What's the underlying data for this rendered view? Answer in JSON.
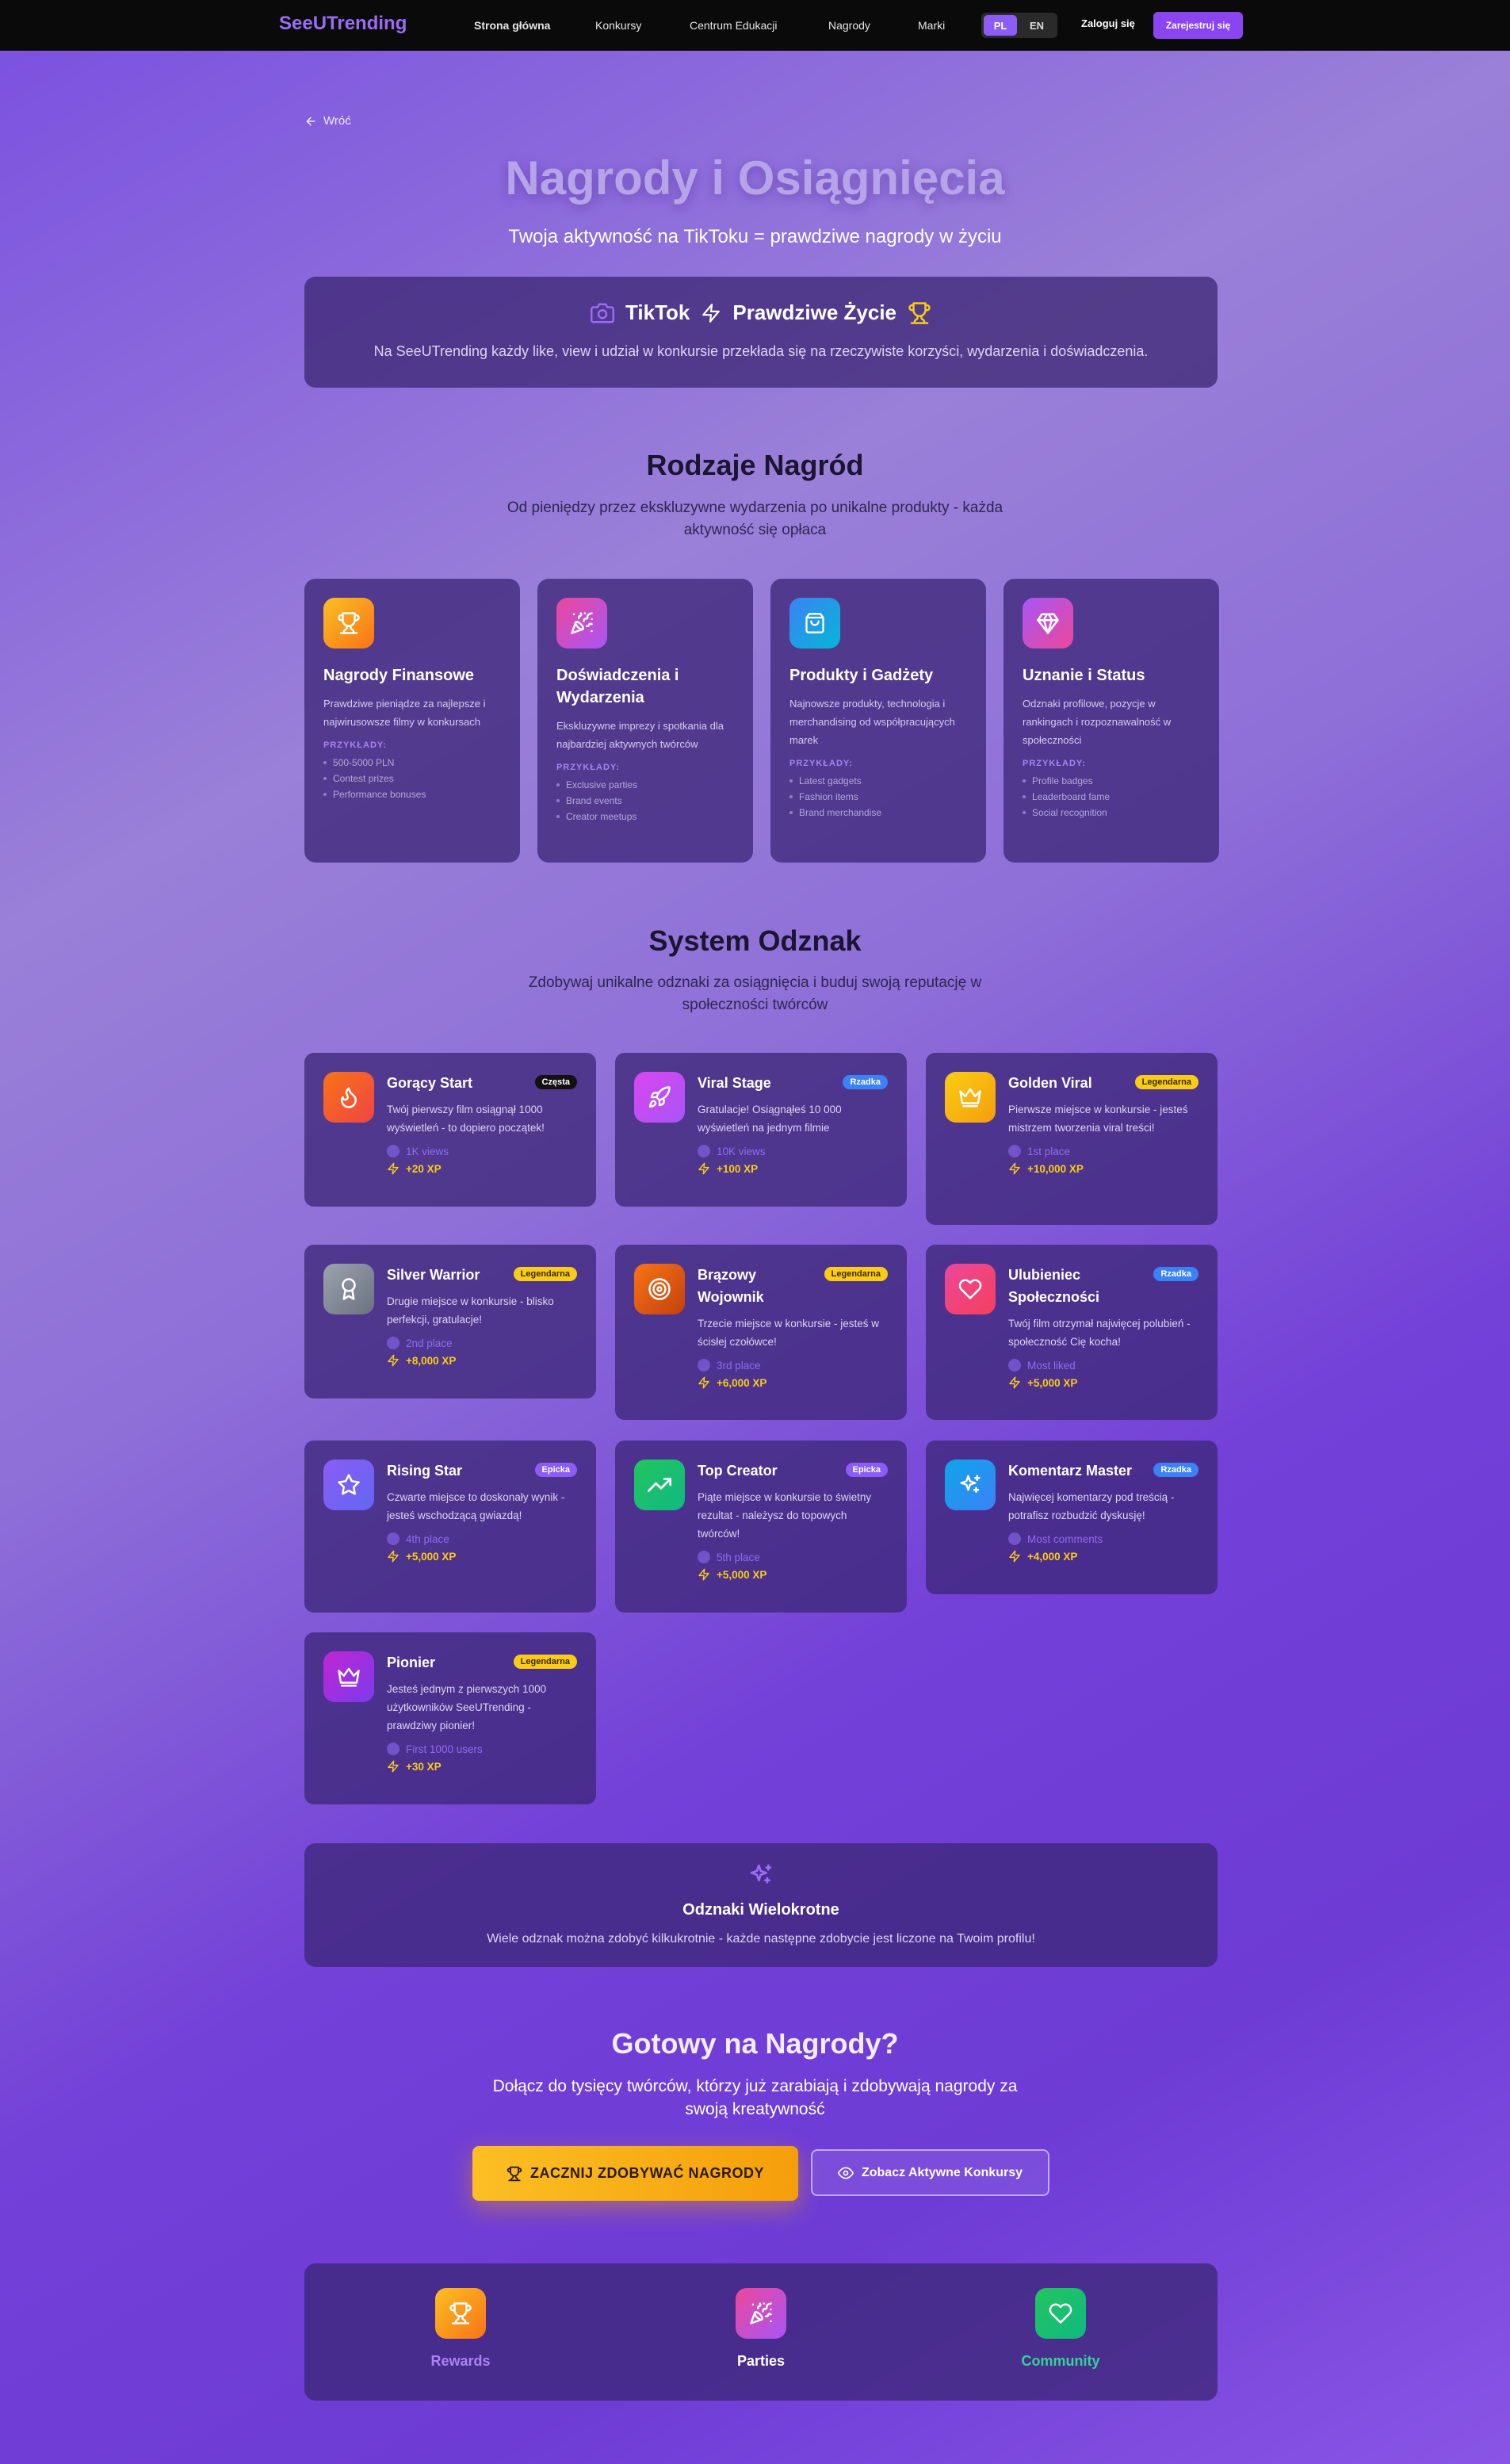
{
  "nav": {
    "brand": "SeeUTrending",
    "links": [
      "Strona główna",
      "Konkursy",
      "Centrum Edukacji",
      "Nagrody",
      "Marki"
    ],
    "lang_pl": "PL",
    "lang_en": "EN",
    "login": "Zaloguj się",
    "register": "Zarejestruj się"
  },
  "colors": {
    "accent": "#8b5cf6",
    "gold": "#facc15",
    "card_bg": "#3e2878"
  },
  "back": {
    "label": "Wróć",
    "icon": "arrow-left-icon"
  },
  "hero": {
    "title": "Nagrody i Osiągnięcia",
    "subtitle": "Twoja aktywność na TikToku = prawdziwe nagrody w życiu",
    "tiktok": "TikTok",
    "real_life": "Prawdziwe Życie",
    "description": "Na SeeUTrending każdy like, view i udział w konkursie przekłada się na rzeczywiste korzyści, wydarzenia i doświadczenia."
  },
  "reward_types": {
    "title": "Rodzaje Nagród",
    "subtitle": "Od pieniędzy przez ekskluzywne wydarzenia po unikalne produkty - każda aktywność się opłaca",
    "examples_label": "PRZYKŁADY:",
    "cards": [
      {
        "icon": "trophy-icon",
        "title": "Nagrody Finansowe",
        "description": "Prawdziwe pieniądze za najlepsze i najwirusowsze filmy w konkursach",
        "examples": [
          "500-5000 PLN",
          "Contest prizes",
          "Performance bonuses"
        ]
      },
      {
        "icon": "party-popper-icon",
        "title": "Doświadczenia i Wydarzenia",
        "description": "Ekskluzywne imprezy i spotkania dla najbardziej aktywnych twórców",
        "examples": [
          "Exclusive parties",
          "Brand events",
          "Creator meetups"
        ]
      },
      {
        "icon": "shopping-bag-icon",
        "title": "Produkty i Gadżety",
        "description": "Najnowsze produkty, technologia i merchandising od współpracujących marek",
        "examples": [
          "Latest gadgets",
          "Fashion items",
          "Brand merchandise"
        ]
      },
      {
        "icon": "diamond-icon",
        "title": "Uznanie i Status",
        "description": "Odznaki profilowe, pozycje w rankingach i rozpoznawalność w społeczności",
        "examples": [
          "Profile badges",
          "Leaderboard fame",
          "Social recognition"
        ]
      }
    ]
  },
  "badges": {
    "title": "System Odznak",
    "subtitle": "Zdobywaj unikalne odznaki za osiągnięcia i buduj swoją reputację w społeczności twórców",
    "items": [
      {
        "icon": "flame-icon",
        "title": "Gorący Start",
        "rarity": "Częsta",
        "description": "Twój pierwszy film osiągnął 1000 wyświetleń - to dopiero początek!",
        "condition": "1K views",
        "xp": "+20 XP"
      },
      {
        "icon": "rocket-icon",
        "title": "Viral Stage",
        "rarity": "Rzadka",
        "description": "Gratulacje! Osiągnąłeś 10 000 wyświetleń na jednym filmie",
        "condition": "10K views",
        "xp": "+100 XP"
      },
      {
        "icon": "crown-icon",
        "title": "Golden Viral",
        "rarity": "Legendarna",
        "description": "Pierwsze miejsce w konkursie - jesteś mistrzem tworzenia viral treści!",
        "condition": "1st place",
        "xp": "+10,000 XP"
      },
      {
        "icon": "medal-icon",
        "title": "Silver Warrior",
        "rarity": "Legendarna",
        "description": "Drugie miejsce w konkursie - blisko perfekcji, gratulacje!",
        "condition": "2nd place",
        "xp": "+8,000 XP"
      },
      {
        "icon": "target-icon",
        "title": "Brązowy Wojownik",
        "rarity": "Legendarna",
        "description": "Trzecie miejsce w konkursie - jesteś w ścisłej czołówce!",
        "condition": "3rd place",
        "xp": "+6,000 XP"
      },
      {
        "icon": "heart-icon",
        "title": "Ulubieniec Społeczności",
        "rarity": "Rzadka",
        "description": "Twój film otrzymał najwięcej polubień - społeczność Cię kocha!",
        "condition": "Most liked",
        "xp": "+5,000 XP"
      },
      {
        "icon": "star-icon",
        "title": "Rising Star",
        "rarity": "Epicka",
        "description": "Czwarte miejsce to doskonały wynik - jesteś wschodzącą gwiazdą!",
        "condition": "4th place",
        "xp": "+5,000 XP"
      },
      {
        "icon": "trending-up-icon",
        "title": "Top Creator",
        "rarity": "Epicka",
        "description": "Piąte miejsce w konkursie to świetny rezultat - należysz do topowych twórców!",
        "condition": "5th place",
        "xp": "+5,000 XP"
      },
      {
        "icon": "sparkles-icon",
        "title": "Komentarz Master",
        "rarity": "Rzadka",
        "description": "Najwięcej komentarzy pod treścią - potrafisz rozbudzić dyskusję!",
        "condition": "Most comments",
        "xp": "+4,000 XP"
      },
      {
        "icon": "crown-icon",
        "title": "Pionier",
        "rarity": "Legendarna",
        "description": "Jesteś jednym z pierwszych 1000 użytkowników SeeUTrending - prawdziwy pionier!",
        "condition": "First 1000 users",
        "xp": "+30 XP"
      }
    ]
  },
  "multi": {
    "icon": "sparkles-icon",
    "title": "Odznaki Wielokrotne",
    "description": "Wiele odznak można zdobyć kilkukrotnie - każde następne zdobycie jest liczone na Twoim profilu!"
  },
  "cta": {
    "title": "Gotowy na Nagrody?",
    "subtitle": "Dołącz do tysięcy twórców, którzy już zarabiają i zdobywają nagrody za swoją kreatywność",
    "primary": "ZACZNIJ ZDOBYWAĆ NAGRODY",
    "secondary": "Zobacz Aktywne Konkursy"
  },
  "footer": {
    "items": [
      {
        "icon": "trophy-icon",
        "label": "Rewards"
      },
      {
        "icon": "party-popper-icon",
        "label": "Parties"
      },
      {
        "icon": "heart-icon",
        "label": "Community"
      }
    ]
  }
}
